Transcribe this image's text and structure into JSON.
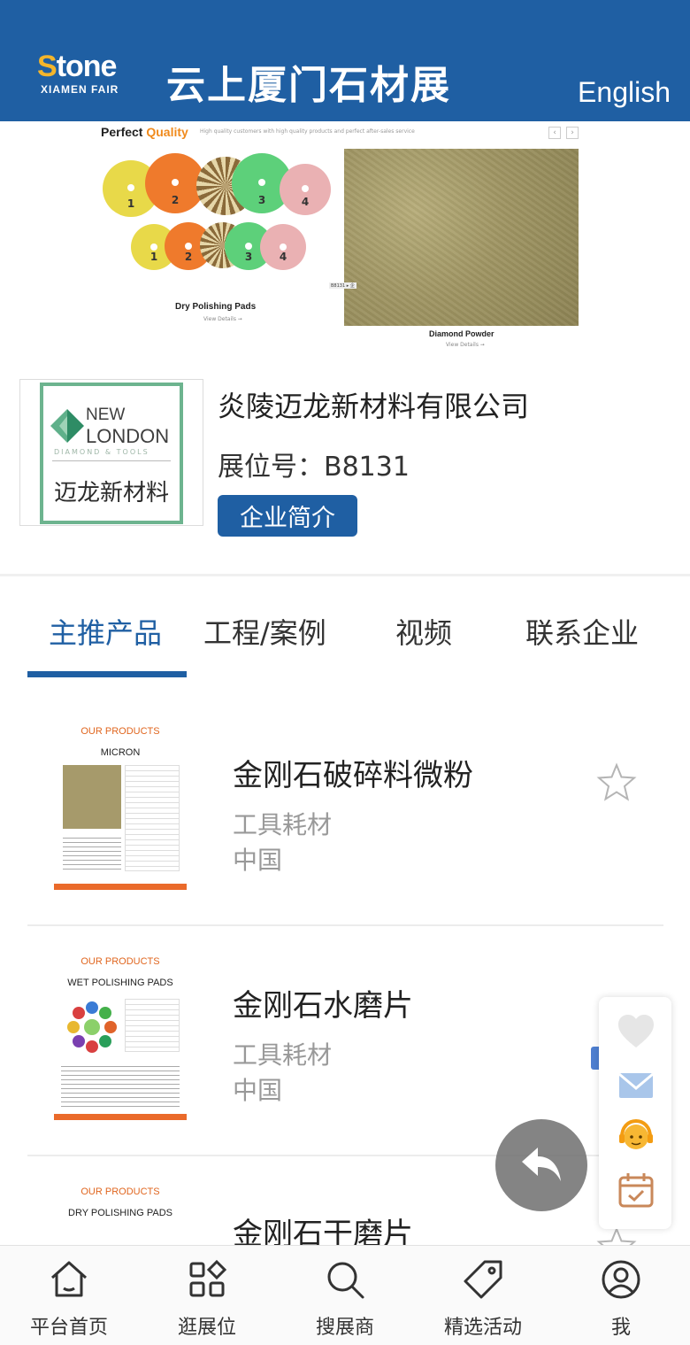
{
  "header": {
    "logo_main": "tone",
    "logo_s": "S",
    "logo_sub": "XIAMEN FAIR",
    "title": "云上厦门石材展",
    "language_button": "English"
  },
  "banner": {
    "heading_prefix": "Perfect ",
    "heading_highlight": "Quality",
    "tagline": "High quality customers with high quality products and perfect after-sales service",
    "left_product": "Dry Polishing Pads",
    "left_link": "View Details ➞",
    "right_product": "Diamond Powder",
    "right_link": "View Details ➞",
    "image_tag": "B8131 ▸ 企",
    "pad_numbers": [
      "1",
      "2",
      "3",
      "4",
      "1",
      "2",
      "3",
      "4"
    ],
    "arrow_prev": "‹",
    "arrow_next": "›"
  },
  "company": {
    "logo_line1": "NEW",
    "logo_line2": "LONDON",
    "logo_sub": "DIAMOND & TOOLS",
    "logo_cn": "迈龙新材料",
    "name": "炎陵迈龙新材料有限公司",
    "booth": "展位号：B8131",
    "intro_button": "企业简介"
  },
  "tabs": [
    {
      "label": "主推产品",
      "active": true
    },
    {
      "label": "工程/案例",
      "active": false
    },
    {
      "label": "视频",
      "active": false
    },
    {
      "label": "联系企业",
      "active": false
    }
  ],
  "products": [
    {
      "name": "金刚石破碎料微粉",
      "category": "工具耗材",
      "origin": "中国",
      "thumb_head": "OUR PRODUCTS",
      "thumb_title": "MICRON"
    },
    {
      "name": "金刚石水磨片",
      "category": "工具耗材",
      "origin": "中国",
      "thumb_head": "OUR PRODUCTS",
      "thumb_title": "WET POLISHING PADS"
    },
    {
      "name": "金刚石干磨片",
      "category": "",
      "origin": "",
      "thumb_head": "OUR PRODUCTS",
      "thumb_title": "DRY POLISHING PADS"
    }
  ],
  "floating": {
    "icons": [
      "heart-icon",
      "mail-icon",
      "customer-service-icon",
      "calendar-icon"
    ],
    "back_icon": "back-arrow-icon"
  },
  "bottom_nav": [
    {
      "label": "平台首页",
      "icon": "home-icon"
    },
    {
      "label": "逛展位",
      "icon": "grid-icon"
    },
    {
      "label": "搜展商",
      "icon": "search-icon"
    },
    {
      "label": "精选活动",
      "icon": "tag-icon"
    },
    {
      "label": "我",
      "icon": "user-icon"
    }
  ],
  "colors": {
    "brand_blue": "#1f5fa3",
    "accent_orange": "#f08a1c",
    "muted_text": "#999999"
  }
}
